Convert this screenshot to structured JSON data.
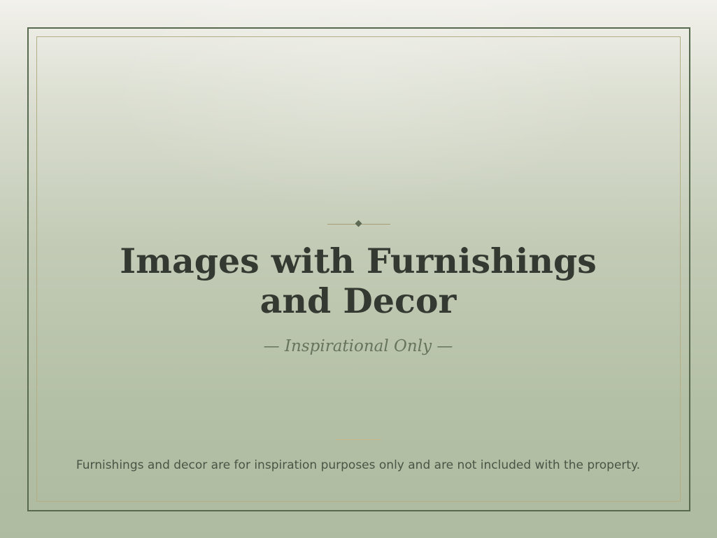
{
  "slide": {
    "title_line_1": "Images with Furnishings",
    "title_line_2": "and Decor",
    "subtitle": "— Inspirational Only —",
    "disclaimer": "Furnishings and decor are for inspiration purposes only and are not included with the property."
  },
  "colors": {
    "frame": "#57694f",
    "inner_frame": "#b3ae86",
    "title": "#343a31",
    "subtitle": "#66745d",
    "disclaimer": "#4a5445",
    "accent": "#a59e76"
  },
  "icons": {
    "ornament": "diamond-divider-icon"
  }
}
